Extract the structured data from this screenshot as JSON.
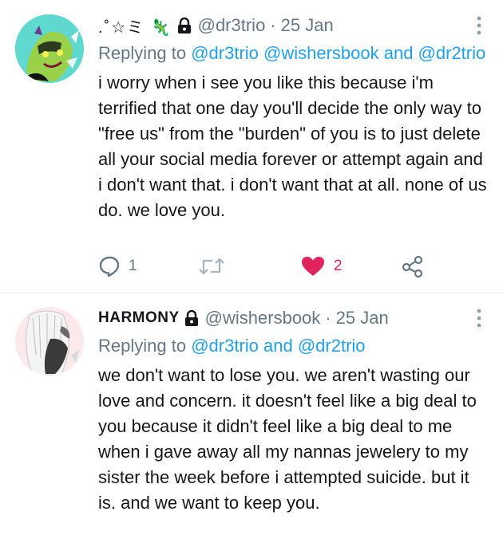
{
  "tweets": [
    {
      "display_name": ".˚☆ミ 🦎 ",
      "handle": "@dr3trio",
      "sep": "·",
      "date": "25 Jan",
      "replying_prefix": "Replying to",
      "replying_to": "@dr3trio @wishersbook and @dr2trio",
      "text": "i worry when i see you like this because i'm terrified that one day you'll decide the only way to \"free us\" from the \"burden\" of you is to just delete all your social media forever or attempt again and i don't want that. i don't want that at all. none of us do. we love you.",
      "actions": {
        "reply_count": "1",
        "retweet_count": "",
        "like_count": "2"
      }
    },
    {
      "display_name": "HARMONY",
      "handle": "@wishersbook",
      "sep": "·",
      "date": "25 Jan",
      "replying_prefix": "Replying to",
      "replying_to": "@dr3trio and @dr2trio",
      "text": "we don't want to lose you. we aren't wasting our love and concern. it doesn't feel like a big deal to you because it didn't feel like a big deal to me when i gave away all my nannas jewelery to my sister the week before i attempted suicide. but it is. and we want to keep you."
    }
  ],
  "colors": {
    "link": "#1da1f2",
    "secondary": "#657786",
    "like": "#e0245e",
    "divider": "#e6ecf0"
  },
  "icons": [
    "more-vertical-icon",
    "lock-icon",
    "reply-icon",
    "retweet-icon",
    "heart-icon",
    "share-icon"
  ]
}
